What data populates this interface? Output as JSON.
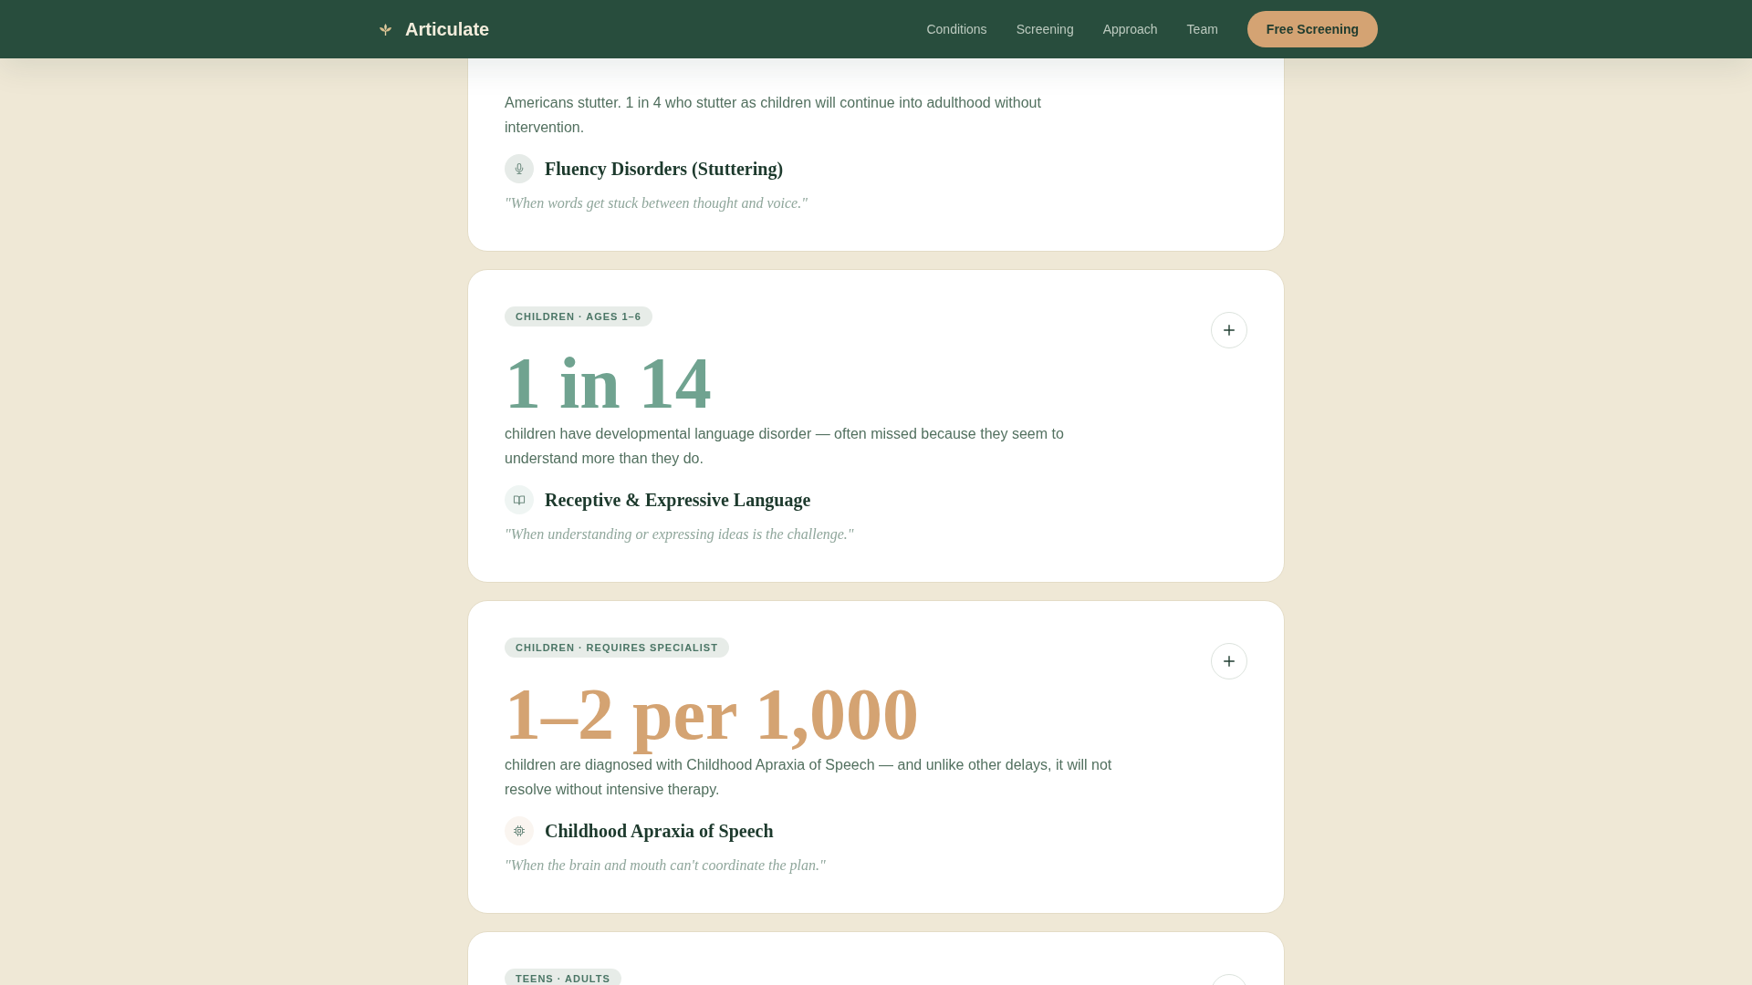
{
  "header": {
    "brand": "Articulate",
    "nav": [
      "Conditions",
      "Screening",
      "Approach",
      "Team"
    ],
    "cta": "Free Screening"
  },
  "conditions": [
    {
      "description": "Americans stutter. 1 in 4 who stutter as children will continue into adulthood without intervention.",
      "title": "Fluency Disorders (Stuttering)",
      "quote": "\"When words get stuck between thought and voice.\""
    },
    {
      "badge": "CHILDREN · AGES 1–6",
      "expanded": false,
      "stat": "1 in 14",
      "color": "#70a390",
      "description": "children have developmental language disorder — often missed because they seem to understand more than they do.",
      "title": "Receptive & Expressive Language",
      "quote": "\"When understanding or expressing ideas is the challenge.\""
    },
    {
      "badge": "CHILDREN · REQUIRES SPECIALIST",
      "expanded": false,
      "stat": "1–2 per 1,000",
      "color": "#d4a372",
      "description": "children are diagnosed with Childhood Apraxia of Speech — and unlike other delays, it will not resolve without intensive therapy.",
      "title": "Childhood Apraxia of Speech",
      "quote": "\"When the brain and mouth can't coordinate the plan.\""
    },
    {
      "badge": "TEENS · ADULTS",
      "expanded": false
    }
  ]
}
